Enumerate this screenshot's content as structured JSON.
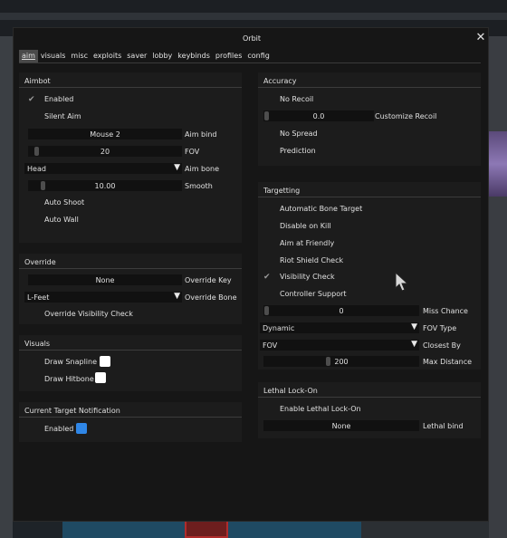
{
  "window": {
    "title": "Orbit",
    "close_icon": "close-icon"
  },
  "tabs": [
    {
      "label": "aim",
      "active": true
    },
    {
      "label": "visuals"
    },
    {
      "label": "misc"
    },
    {
      "label": "exploits"
    },
    {
      "label": "saver"
    },
    {
      "label": "lobby"
    },
    {
      "label": "keybinds"
    },
    {
      "label": "profiles"
    },
    {
      "label": "config"
    }
  ],
  "aimbot": {
    "header": "Aimbot",
    "enabled": {
      "label": "Enabled",
      "checked": true
    },
    "silent_aim": {
      "label": "Silent Aim",
      "checked": false
    },
    "aim_bind": {
      "value": "Mouse 2",
      "label": "Aim bind"
    },
    "fov": {
      "value": "20",
      "label": "FOV"
    },
    "aim_bone": {
      "value": "Head",
      "label": "Aim bone"
    },
    "smooth": {
      "value": "10.00",
      "label": "Smooth"
    },
    "auto_shoot": {
      "label": "Auto Shoot",
      "checked": false
    },
    "auto_wall": {
      "label": "Auto Wall",
      "checked": false
    }
  },
  "override": {
    "header": "Override",
    "override_key": {
      "value": "None",
      "label": "Override Key"
    },
    "override_bone": {
      "value": "L-Feet",
      "label": "Override Bone"
    },
    "override_visibility": {
      "label": "Override Visibility Check",
      "checked": false
    }
  },
  "visuals": {
    "header": "Visuals",
    "draw_snapline": {
      "label": "Draw Snapline",
      "checked": false,
      "color": "#ffffff"
    },
    "draw_hitbone": {
      "label": "Draw Hitbone",
      "checked": false,
      "color": "#ffffff"
    }
  },
  "target_notification": {
    "header": "Current Target Notification",
    "enabled": {
      "label": "Enabled",
      "checked": false,
      "color": "#2f86e6"
    }
  },
  "accuracy": {
    "header": "Accuracy",
    "no_recoil": {
      "label": "No Recoil",
      "checked": false
    },
    "custom_recoil": {
      "value": "0.0",
      "label": "Customize Recoil"
    },
    "no_spread": {
      "label": "No Spread",
      "checked": false
    },
    "prediction": {
      "label": "Prediction",
      "checked": false
    }
  },
  "targetting": {
    "header": "Targetting",
    "auto_bone": {
      "label": "Automatic Bone Target",
      "checked": false
    },
    "disable_on_kill": {
      "label": "Disable on Kill",
      "checked": false
    },
    "aim_at_friendly": {
      "label": "Aim at Friendly",
      "checked": false
    },
    "riot_shield": {
      "label": "Riot Shield Check",
      "checked": false
    },
    "visibility_check": {
      "label": "Visibility Check",
      "checked": true
    },
    "controller_support": {
      "label": "Controller Support",
      "checked": false
    },
    "miss_chance": {
      "value": "0",
      "label": "Miss Chance"
    },
    "fov_type": {
      "value": "Dynamic",
      "label": "FOV Type"
    },
    "closest_by": {
      "value": "FOV",
      "label": "Closest By"
    },
    "max_distance": {
      "value": "200",
      "label": "Max Distance"
    }
  },
  "lethal_lockon": {
    "header": "Lethal Lock-On",
    "enable": {
      "label": "Enable Lethal Lock-On",
      "checked": false
    },
    "lethal_bind": {
      "value": "None",
      "label": "Lethal bind"
    }
  },
  "icons": {
    "check": "checkmark-icon",
    "dropdown": "triangle-down-icon",
    "cursor": "mouse-cursor-icon"
  }
}
